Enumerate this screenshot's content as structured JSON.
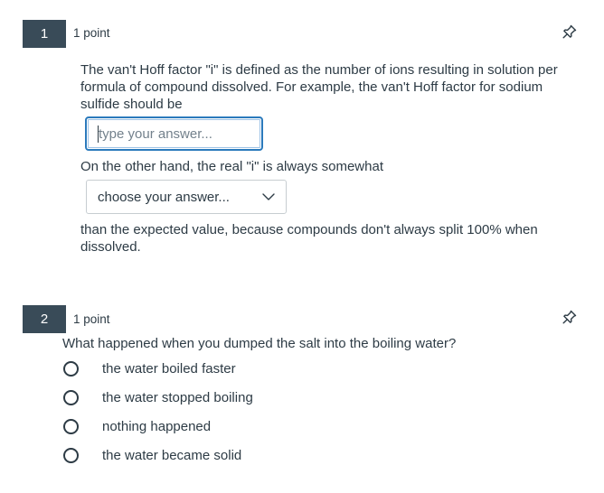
{
  "questions": [
    {
      "number": "1",
      "points": "1 point",
      "intro": "The van't Hoff factor \"i\" is defined as the number of ions resulting in solution per formula of compound dissolved. For example, the van't Hoff factor for sodium sulfide should be",
      "answer_placeholder": "type your answer...",
      "middle": "On the other hand, the real \"i\" is always somewhat",
      "select_value": "choose your answer...",
      "outro": "than the expected value, because compounds don't always split 100% when dissolved."
    },
    {
      "number": "2",
      "points": "1 point",
      "prompt": "What happened when you dumped the salt into the boiling water?",
      "options": [
        "the water boiled faster",
        "the water stopped boiling",
        "nothing happened",
        "the water became solid"
      ]
    }
  ],
  "icons": {
    "pin": "pin-icon",
    "dropdown": "chevron-down-icon",
    "radio": "radio-unselected"
  },
  "colors": {
    "number_badge": "#394b58",
    "text": "#2d3b45",
    "focus_border": "#2b7abc"
  }
}
